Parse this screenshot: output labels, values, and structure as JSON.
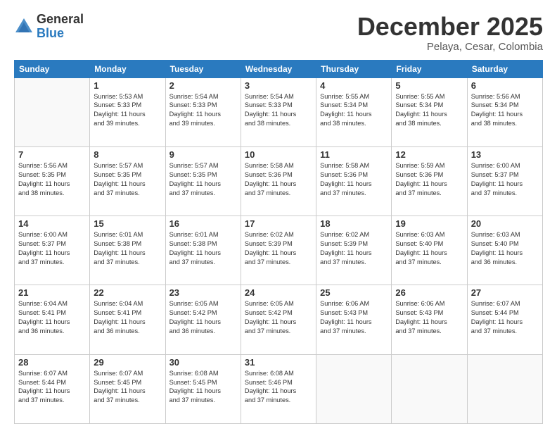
{
  "header": {
    "logo_general": "General",
    "logo_blue": "Blue",
    "month_title": "December 2025",
    "subtitle": "Pelaya, Cesar, Colombia"
  },
  "days_of_week": [
    "Sunday",
    "Monday",
    "Tuesday",
    "Wednesday",
    "Thursday",
    "Friday",
    "Saturday"
  ],
  "weeks": [
    [
      {
        "num": "",
        "info": ""
      },
      {
        "num": "1",
        "info": "Sunrise: 5:53 AM\nSunset: 5:33 PM\nDaylight: 11 hours\nand 39 minutes."
      },
      {
        "num": "2",
        "info": "Sunrise: 5:54 AM\nSunset: 5:33 PM\nDaylight: 11 hours\nand 39 minutes."
      },
      {
        "num": "3",
        "info": "Sunrise: 5:54 AM\nSunset: 5:33 PM\nDaylight: 11 hours\nand 38 minutes."
      },
      {
        "num": "4",
        "info": "Sunrise: 5:55 AM\nSunset: 5:34 PM\nDaylight: 11 hours\nand 38 minutes."
      },
      {
        "num": "5",
        "info": "Sunrise: 5:55 AM\nSunset: 5:34 PM\nDaylight: 11 hours\nand 38 minutes."
      },
      {
        "num": "6",
        "info": "Sunrise: 5:56 AM\nSunset: 5:34 PM\nDaylight: 11 hours\nand 38 minutes."
      }
    ],
    [
      {
        "num": "7",
        "info": "Sunrise: 5:56 AM\nSunset: 5:35 PM\nDaylight: 11 hours\nand 38 minutes."
      },
      {
        "num": "8",
        "info": "Sunrise: 5:57 AM\nSunset: 5:35 PM\nDaylight: 11 hours\nand 37 minutes."
      },
      {
        "num": "9",
        "info": "Sunrise: 5:57 AM\nSunset: 5:35 PM\nDaylight: 11 hours\nand 37 minutes."
      },
      {
        "num": "10",
        "info": "Sunrise: 5:58 AM\nSunset: 5:36 PM\nDaylight: 11 hours\nand 37 minutes."
      },
      {
        "num": "11",
        "info": "Sunrise: 5:58 AM\nSunset: 5:36 PM\nDaylight: 11 hours\nand 37 minutes."
      },
      {
        "num": "12",
        "info": "Sunrise: 5:59 AM\nSunset: 5:36 PM\nDaylight: 11 hours\nand 37 minutes."
      },
      {
        "num": "13",
        "info": "Sunrise: 6:00 AM\nSunset: 5:37 PM\nDaylight: 11 hours\nand 37 minutes."
      }
    ],
    [
      {
        "num": "14",
        "info": "Sunrise: 6:00 AM\nSunset: 5:37 PM\nDaylight: 11 hours\nand 37 minutes."
      },
      {
        "num": "15",
        "info": "Sunrise: 6:01 AM\nSunset: 5:38 PM\nDaylight: 11 hours\nand 37 minutes."
      },
      {
        "num": "16",
        "info": "Sunrise: 6:01 AM\nSunset: 5:38 PM\nDaylight: 11 hours\nand 37 minutes."
      },
      {
        "num": "17",
        "info": "Sunrise: 6:02 AM\nSunset: 5:39 PM\nDaylight: 11 hours\nand 37 minutes."
      },
      {
        "num": "18",
        "info": "Sunrise: 6:02 AM\nSunset: 5:39 PM\nDaylight: 11 hours\nand 37 minutes."
      },
      {
        "num": "19",
        "info": "Sunrise: 6:03 AM\nSunset: 5:40 PM\nDaylight: 11 hours\nand 37 minutes."
      },
      {
        "num": "20",
        "info": "Sunrise: 6:03 AM\nSunset: 5:40 PM\nDaylight: 11 hours\nand 36 minutes."
      }
    ],
    [
      {
        "num": "21",
        "info": "Sunrise: 6:04 AM\nSunset: 5:41 PM\nDaylight: 11 hours\nand 36 minutes."
      },
      {
        "num": "22",
        "info": "Sunrise: 6:04 AM\nSunset: 5:41 PM\nDaylight: 11 hours\nand 36 minutes."
      },
      {
        "num": "23",
        "info": "Sunrise: 6:05 AM\nSunset: 5:42 PM\nDaylight: 11 hours\nand 36 minutes."
      },
      {
        "num": "24",
        "info": "Sunrise: 6:05 AM\nSunset: 5:42 PM\nDaylight: 11 hours\nand 37 minutes."
      },
      {
        "num": "25",
        "info": "Sunrise: 6:06 AM\nSunset: 5:43 PM\nDaylight: 11 hours\nand 37 minutes."
      },
      {
        "num": "26",
        "info": "Sunrise: 6:06 AM\nSunset: 5:43 PM\nDaylight: 11 hours\nand 37 minutes."
      },
      {
        "num": "27",
        "info": "Sunrise: 6:07 AM\nSunset: 5:44 PM\nDaylight: 11 hours\nand 37 minutes."
      }
    ],
    [
      {
        "num": "28",
        "info": "Sunrise: 6:07 AM\nSunset: 5:44 PM\nDaylight: 11 hours\nand 37 minutes."
      },
      {
        "num": "29",
        "info": "Sunrise: 6:07 AM\nSunset: 5:45 PM\nDaylight: 11 hours\nand 37 minutes."
      },
      {
        "num": "30",
        "info": "Sunrise: 6:08 AM\nSunset: 5:45 PM\nDaylight: 11 hours\nand 37 minutes."
      },
      {
        "num": "31",
        "info": "Sunrise: 6:08 AM\nSunset: 5:46 PM\nDaylight: 11 hours\nand 37 minutes."
      },
      {
        "num": "",
        "info": ""
      },
      {
        "num": "",
        "info": ""
      },
      {
        "num": "",
        "info": ""
      }
    ]
  ]
}
